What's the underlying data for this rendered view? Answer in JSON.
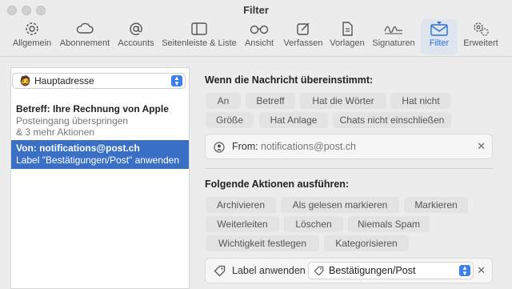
{
  "window": {
    "title": "Filter"
  },
  "toolbar": {
    "items": [
      {
        "label": "Allgemein",
        "icon": "gear-icon"
      },
      {
        "label": "Abonnement",
        "icon": "cloud-icon"
      },
      {
        "label": "Accounts",
        "icon": "at-sign-icon"
      },
      {
        "label": "Seitenleiste & Liste",
        "icon": "sidebar-icon"
      },
      {
        "label": "Ansicht",
        "icon": "glasses-icon"
      },
      {
        "label": "Verfassen",
        "icon": "compose-icon"
      },
      {
        "label": "Vorlagen",
        "icon": "document-icon"
      },
      {
        "label": "Signaturen",
        "icon": "signature-icon"
      },
      {
        "label": "Filter",
        "icon": "filter-envelope-icon",
        "active": true
      },
      {
        "label": "Erweitert",
        "icon": "gears-icon"
      }
    ]
  },
  "sidebar": {
    "account": "Hauptadresse",
    "rules": [
      {
        "title": "Betreff: Ihre Rechnung von Apple",
        "line1": "Posteingang überspringen",
        "line2": "& 3 mehr Aktionen"
      },
      {
        "title": "Von: notifications@post.ch",
        "line1": "Label \"Bestätigungen/Post\" anwenden",
        "line2": ""
      }
    ]
  },
  "conditions": {
    "heading": "Wenn die Nachricht übereinstimmt:",
    "chips": [
      "An",
      "Betreff",
      "Hat die Wörter",
      "Hat nicht",
      "Größe",
      "Hat Anlage",
      "Chats nicht einschließen"
    ],
    "from_label": "From:",
    "from_value": "notifications@post.ch"
  },
  "actions": {
    "heading": "Folgende Aktionen ausführen:",
    "chips": [
      "Archivieren",
      "Als gelesen markieren",
      "Markieren",
      "Weiterleiten",
      "Löschen",
      "Niemals Spam",
      "Wichtigkeit festlegen",
      "Kategorisieren"
    ],
    "label_action": "Label anwenden",
    "label_value": "Bestätigungen/Post"
  },
  "colors": {
    "accent": "#2b6fd6",
    "selection": "#3a6fc6"
  }
}
